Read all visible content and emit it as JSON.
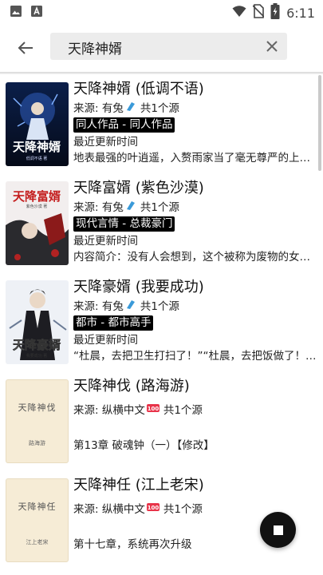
{
  "status": {
    "time": "6:11"
  },
  "search": {
    "query": "天降神婿"
  },
  "books": [
    {
      "title": "天降神婿 (低调不语)",
      "source": "来源: 有兔",
      "count": "共1个源",
      "tag": "同人作品 - 同人作品",
      "update": "最近更新时间",
      "intro": "地表最强的叶逍遥，入赘雨家当了毫无尊严的上门女婿……",
      "cover_title": "天降神婿",
      "cover_author": "低调不语 著"
    },
    {
      "title": "天降富婿 (紫色沙漠)",
      "source": "来源: 有兔",
      "count": "共1个源",
      "tag": "现代言情 - 总裁豪门",
      "update": "最近更新时间",
      "intro": "内容简介：没有人会想到，这个被称为废物的女婿……",
      "cover_title": "天降富婿",
      "cover_author": "紫色沙漠 著"
    },
    {
      "title": "天降豪婿 (我要成功)",
      "source": "来源: 有兔",
      "count": "共1个源",
      "tag": "都市 - 都市高手",
      "update": "最近更新时间",
      "intro": "“杜晨，去把卫生打扫了！”“杜晨，去把饭做了！”“……",
      "cover_title": "天降豪婿",
      "cover_author": "我要成功 著"
    },
    {
      "title": "天降神伐 (路海游)",
      "source": "来源: 纵横中文",
      "count": "共1个源",
      "chapter": "第13章 破魂钟（一）【修改】",
      "cover_title": "天降神伐",
      "cover_author": "路海游"
    },
    {
      "title": "天降神任 (江上老宋)",
      "source": "来源: 纵横中文",
      "count": "共1个源",
      "chapter": "第十七章，系统再次升级",
      "cover_title": "天降神任",
      "cover_author": "江上老宋"
    }
  ],
  "colors": {
    "accent": "#000000",
    "tag_bg": "#000000",
    "search_bg": "#ececec",
    "fab": "#111111",
    "zongheng_icon": "#e8344a",
    "youtu_icon": "#3a9ad9"
  },
  "icons": [
    "image-icon",
    "font-icon",
    "wifi-icon",
    "no-sim-icon",
    "battery-charging-icon",
    "back-arrow-icon",
    "clear-icon",
    "stop-icon"
  ]
}
